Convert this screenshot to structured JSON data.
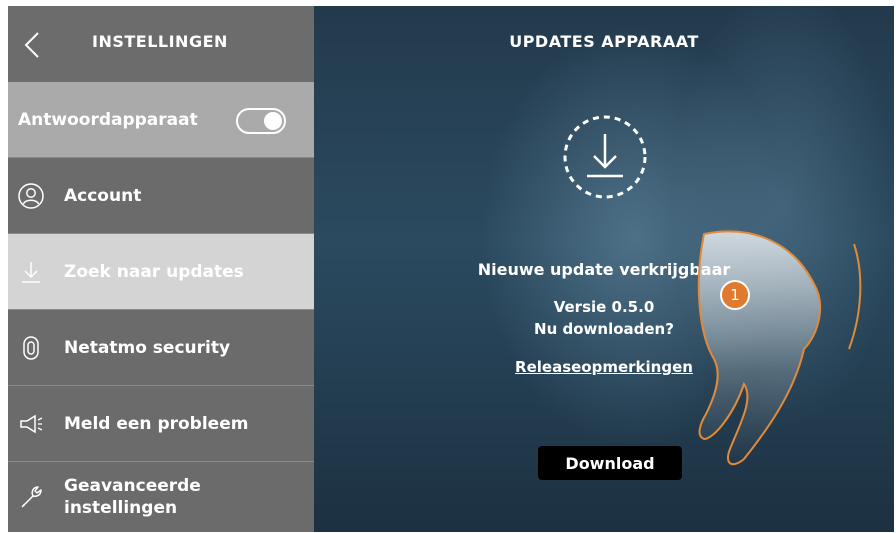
{
  "sidebar": {
    "title": "INSTELLINGEN",
    "items": [
      {
        "label": "Antwoordapparaat",
        "toggle_on": true
      },
      {
        "label": "Account",
        "icon": "user-icon"
      },
      {
        "label": "Zoek naar updates",
        "icon": "download-arrow-icon",
        "selected": true
      },
      {
        "label": "Netatmo security",
        "icon": "netatmo-icon"
      },
      {
        "label": "Meld een probleem",
        "icon": "megaphone-icon"
      },
      {
        "label": "Geavanceerde instellingen",
        "icon": "wrench-icon"
      }
    ]
  },
  "main": {
    "title": "UPDATES APPARAAT",
    "update_title": "Nieuwe update verkrijgbaar",
    "version": "Versie 0.5.0",
    "prompt": "Nu downloaden?",
    "release_notes_link": "Releaseopmerkingen",
    "download_button": "Download"
  },
  "annotation": {
    "step_number": "1"
  },
  "colors": {
    "sidebar_bg": "#6b6b6b",
    "answer_row_bg": "#aaaaaa",
    "selected_row_bg": "#d4d4d4",
    "step_badge": "#e07a2e",
    "button_bg": "#000000"
  }
}
